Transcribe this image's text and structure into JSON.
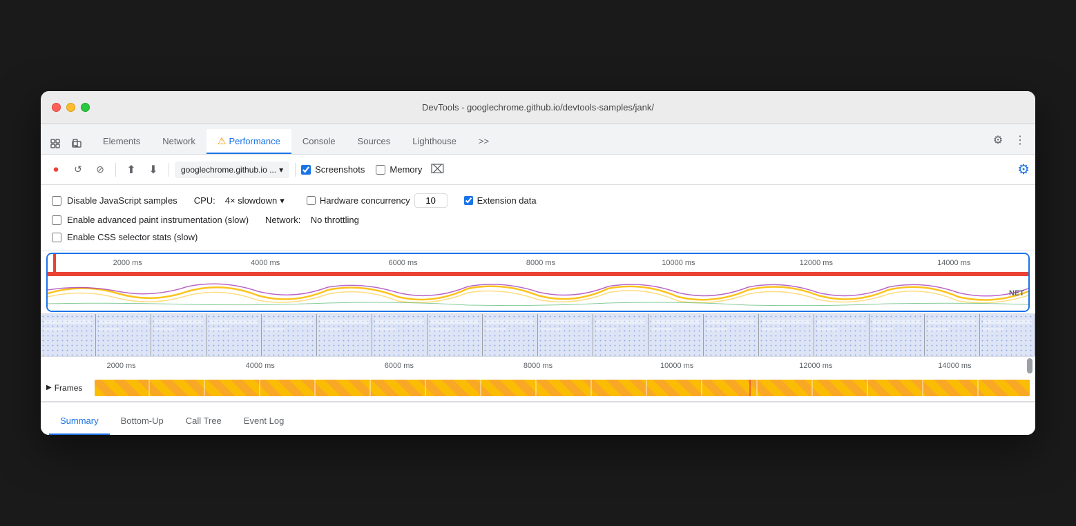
{
  "window": {
    "title": "DevTools - googlechrome.github.io/devtools-samples/jank/"
  },
  "tabs": {
    "items": [
      {
        "label": "Elements",
        "active": false
      },
      {
        "label": "Network",
        "active": false
      },
      {
        "label": "Performance",
        "active": true,
        "warning": true
      },
      {
        "label": "Console",
        "active": false
      },
      {
        "label": "Sources",
        "active": false
      },
      {
        "label": "Lighthouse",
        "active": false
      },
      {
        "label": ">>",
        "active": false
      }
    ]
  },
  "perf_toolbar": {
    "record_label": "●",
    "refresh_label": "↺",
    "clear_label": "⊘",
    "upload_label": "⬆",
    "download_label": "⬇",
    "url_label": "googlechrome.github.io ...",
    "screenshots_label": "Screenshots",
    "memory_label": "Memory",
    "clean_label": "⌧",
    "settings_label": "⚙"
  },
  "settings": {
    "disable_js_label": "Disable JavaScript samples",
    "advanced_paint_label": "Enable advanced paint instrumentation (slow)",
    "css_selector_label": "Enable CSS selector stats (slow)",
    "cpu_label": "CPU:",
    "cpu_value": "4× slowdown",
    "network_label": "Network:",
    "network_value": "No throttling",
    "hw_concurrency_label": "Hardware concurrency",
    "hw_value": "10",
    "ext_data_label": "Extension data"
  },
  "timeline": {
    "ruler_marks": [
      "2000 ms",
      "4000 ms",
      "6000 ms",
      "8000 ms",
      "10000 ms",
      "12000 ms",
      "14000 ms"
    ],
    "ruler2_marks": [
      "2000 ms",
      "4000 ms",
      "6000 ms",
      "8000 ms",
      "10000 ms",
      "12000 ms",
      "14000 ms"
    ],
    "net_label": "NET",
    "frames_label": "Frames"
  },
  "bottom_tabs": {
    "items": [
      {
        "label": "Summary",
        "active": true
      },
      {
        "label": "Bottom-Up",
        "active": false
      },
      {
        "label": "Call Tree",
        "active": false
      },
      {
        "label": "Event Log",
        "active": false
      }
    ]
  },
  "icons": {
    "record": "⏺",
    "refresh": "↺",
    "clear": "⊘",
    "upload": "⬆",
    "download": "⬇",
    "settings": "⚙",
    "more": "⋮",
    "cursor": "⬡",
    "device": "▭",
    "triangle": "▶",
    "dropdown": "▾"
  }
}
